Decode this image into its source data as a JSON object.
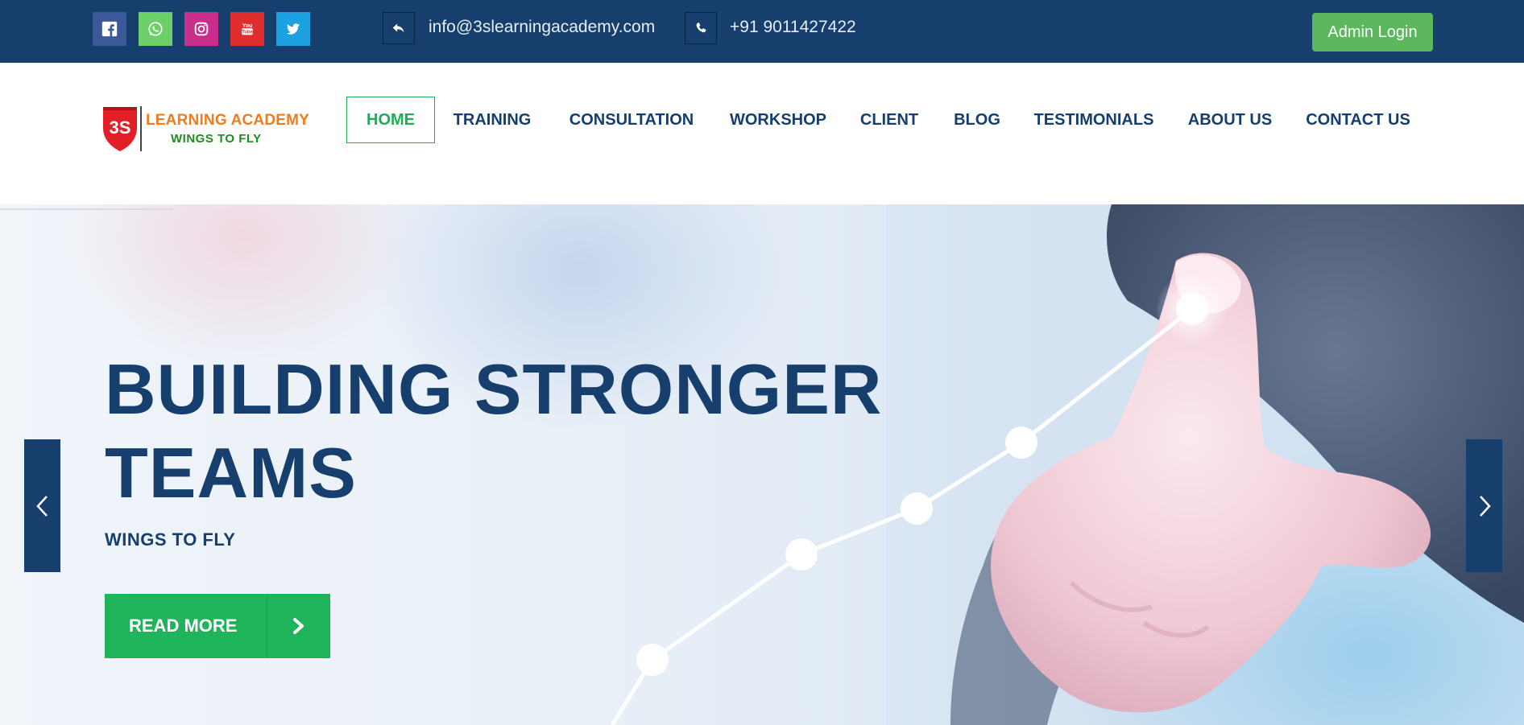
{
  "topbar": {
    "socials": [
      {
        "name": "facebook-icon",
        "color": "#3b5998"
      },
      {
        "name": "whatsapp-icon",
        "color": "#6ccf6a"
      },
      {
        "name": "instagram-icon",
        "color": "#c92e8d"
      },
      {
        "name": "youtube-icon",
        "color": "#e02d2d"
      },
      {
        "name": "twitter-icon",
        "color": "#1da1e0"
      }
    ],
    "email": "info@3slearningacademy.com",
    "phone": "+91 9011427422",
    "admin_login": "Admin Login"
  },
  "logo": {
    "badge": "3S",
    "line1": "LEARNING ACADEMY",
    "line2": "WINGS TO FLY"
  },
  "nav": {
    "items": [
      {
        "label": "HOME",
        "active": true
      },
      {
        "label": "TRAINING"
      },
      {
        "label": "CONSULTATION"
      },
      {
        "label": "WORKSHOP"
      },
      {
        "label": "CLIENT"
      },
      {
        "label": "BLOG"
      },
      {
        "label": "TESTIMONIALS"
      },
      {
        "label": "ABOUT US"
      },
      {
        "label": "CONTACT US"
      }
    ]
  },
  "hero": {
    "title_line1": "BUILDING STRONGER",
    "title_line2": "TEAMS",
    "subtitle": "WINGS TO FLY",
    "cta": "READ MORE",
    "prev_icon": "chevron-left-icon",
    "next_icon": "chevron-right-icon"
  },
  "colors": {
    "brand_navy": "#173f6e",
    "accent_green": "#1fb35a",
    "admin_green": "#5cb85c",
    "logo_red": "#e21f26",
    "logo_orange": "#f07c1c"
  }
}
